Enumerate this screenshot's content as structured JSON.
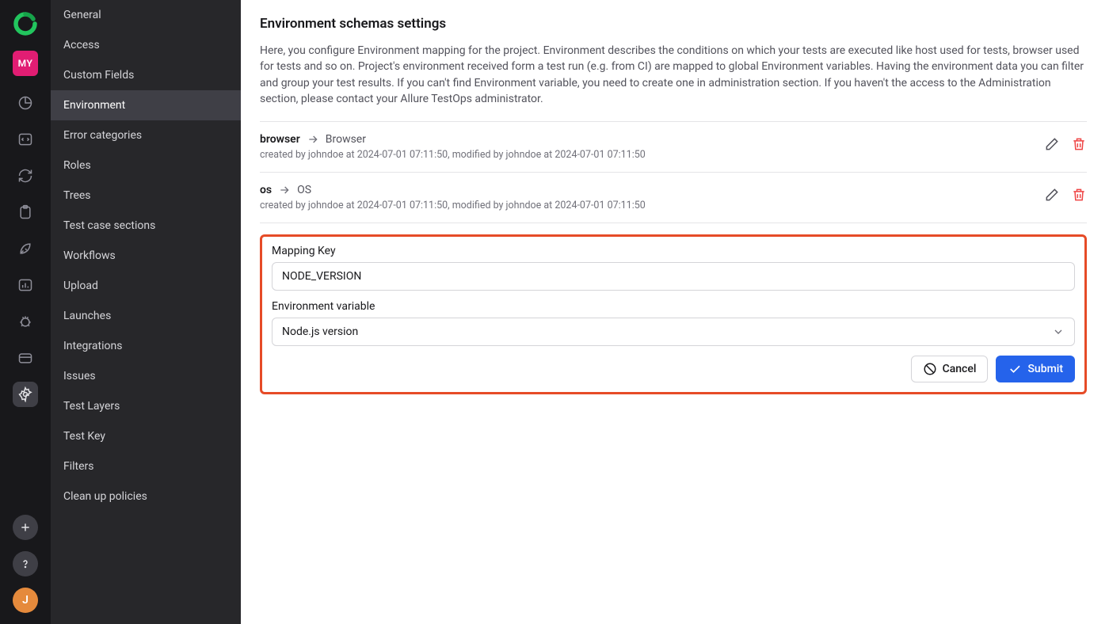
{
  "rail": {
    "project_badge": "MY",
    "user_initial": "J"
  },
  "sidebar": {
    "items": [
      {
        "label": "General",
        "active": false
      },
      {
        "label": "Access",
        "active": false
      },
      {
        "label": "Custom Fields",
        "active": false
      },
      {
        "label": "Environment",
        "active": true
      },
      {
        "label": "Error categories",
        "active": false
      },
      {
        "label": "Roles",
        "active": false
      },
      {
        "label": "Trees",
        "active": false
      },
      {
        "label": "Test case sections",
        "active": false
      },
      {
        "label": "Workflows",
        "active": false
      },
      {
        "label": "Upload",
        "active": false
      },
      {
        "label": "Launches",
        "active": false
      },
      {
        "label": "Integrations",
        "active": false
      },
      {
        "label": "Issues",
        "active": false
      },
      {
        "label": "Test Layers",
        "active": false
      },
      {
        "label": "Test Key",
        "active": false
      },
      {
        "label": "Filters",
        "active": false
      },
      {
        "label": "Clean up policies",
        "active": false
      }
    ]
  },
  "main": {
    "title": "Environment schemas settings",
    "description": "Here, you configure Environment mapping for the project. Environment describes the conditions on which your tests are executed like host used for tests, browser used for tests and so on. Project's environment received form a test run (e.g. from CI) are mapped to global Environment variables. Having the environment data you can filter and group your test results. If you can't find Environment variable, you need to create one in administration section. If you haven't the access to the Administration section, please contact your Allure TestOps administrator.",
    "mappings": [
      {
        "key": "browser",
        "value": "Browser",
        "meta": "created by johndoe at 2024-07-01 07:11:50, modified by johndoe at 2024-07-01 07:11:50"
      },
      {
        "key": "os",
        "value": "OS",
        "meta": "created by johndoe at 2024-07-01 07:11:50, modified by johndoe at 2024-07-01 07:11:50"
      }
    ],
    "form": {
      "mapping_key_label": "Mapping Key",
      "mapping_key_value": "NODE_VERSION",
      "env_var_label": "Environment variable",
      "env_var_value": "Node.js version",
      "cancel_label": "Cancel",
      "submit_label": "Submit"
    }
  }
}
